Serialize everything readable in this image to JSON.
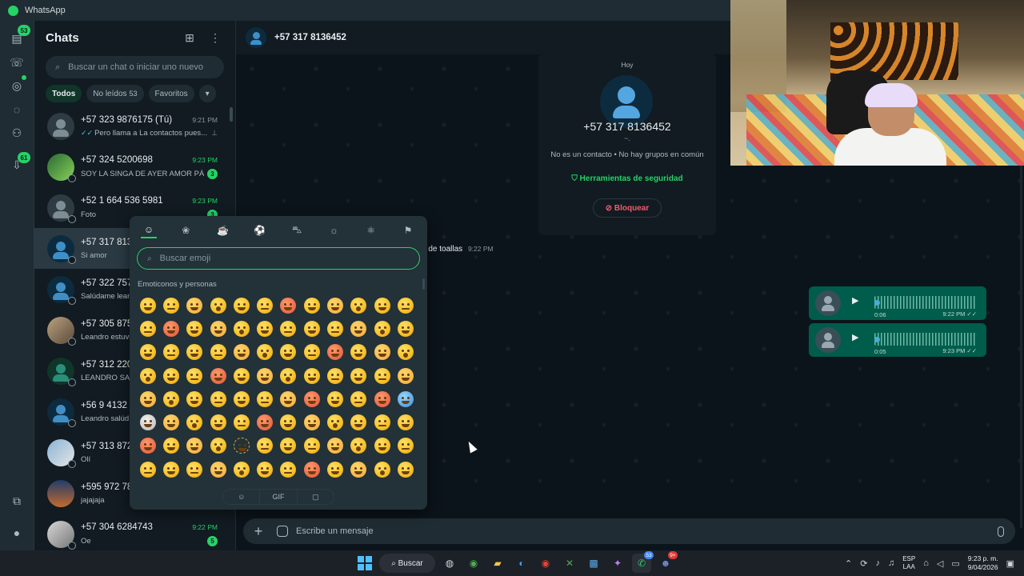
{
  "window": {
    "title": "WhatsApp"
  },
  "rail": {
    "chats_badge": "53",
    "channels_badge": "61"
  },
  "chatlist": {
    "title": "Chats",
    "search_placeholder": "Buscar un chat o iniciar uno nuevo",
    "filters": [
      {
        "label": "Todos"
      },
      {
        "label": "No leídos",
        "count": "53"
      },
      {
        "label": "Favoritos"
      }
    ],
    "items": [
      {
        "name": "+57 323 9876175 (Tú)",
        "time": "9:21 PM",
        "preview": "Pero llama a La contactos  pues...",
        "ticks": "✓✓",
        "pinned": true
      },
      {
        "name": "+57 324 5200698",
        "time": "9:23 PM",
        "preview": "SOY LA SINGA DE AYER AMOR PÁG...",
        "unread": "3"
      },
      {
        "name": "+52 1 664 536 5981",
        "time": "9:23 PM",
        "preview": "Foto",
        "unread": "3"
      },
      {
        "name": "+57 317 8136452",
        "time": "",
        "preview": "Si amor"
      },
      {
        "name": "+57 322 757",
        "time": "",
        "preview": "Salúdame lean"
      },
      {
        "name": "+57 305 875",
        "time": "",
        "preview": "Leandro estuvi"
      },
      {
        "name": "+57 312 220",
        "time": "",
        "preview": "LEANDRO SAL"
      },
      {
        "name": "+56 9 4132 3",
        "time": "",
        "preview": "Leandro salúd"
      },
      {
        "name": "+57 313 872",
        "time": "",
        "preview": "Olí"
      },
      {
        "name": "+595 972 78",
        "time": "",
        "preview": "jajajaja"
      },
      {
        "name": "+57 304 6284743",
        "time": "9:22 PM",
        "preview": "Oe",
        "unread": "5"
      }
    ]
  },
  "conversation": {
    "name": "+57 317 8136452",
    "info": {
      "date": "Hoy",
      "phone": "+57 317 8136452",
      "tilde": "~.",
      "subtitle": "No es un contacto • No hay grupos en común",
      "safety_label": "Herramientas de seguridad",
      "block_label": "Bloquear"
    },
    "incoming_fragment": {
      "text": "e de toallas",
      "time": "9:22 PM"
    },
    "voice_notes": [
      {
        "duration": "0:06",
        "time": "9:22 PM"
      },
      {
        "duration": "0:05",
        "time": "9:23 PM"
      }
    ],
    "composer_placeholder": "Escribe un mensaje"
  },
  "emoji_picker": {
    "categories": [
      "smileys-icon",
      "animals-icon",
      "food-icon",
      "activity-icon",
      "travel-icon",
      "objects-icon",
      "symbols-icon",
      "flags-icon"
    ],
    "search_placeholder": "Buscar emoji",
    "section_title": "Emoticonos y personas",
    "tabs": [
      "☺",
      "GIF",
      "▢"
    ]
  },
  "taskbar": {
    "search_label": "Buscar",
    "lang_top": "ESP",
    "lang_bottom": "LAA",
    "time": "9:23 p. m.",
    "date": "9/04/2026",
    "whatsapp_badge": "53",
    "discord_badge": "9+"
  },
  "colors": {
    "accent": "#25d366",
    "bubble_out": "#005c4b",
    "background": "#0b141a",
    "panel": "#111b21"
  }
}
